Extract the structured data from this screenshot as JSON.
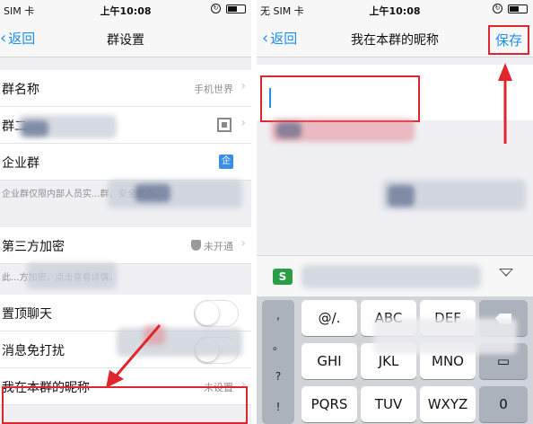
{
  "left_screen": {
    "status": {
      "carrier": "SIM 卡",
      "time": "上午10:08"
    },
    "nav": {
      "back_label": "返回",
      "title": "群设置"
    },
    "rows": {
      "group_name": {
        "label": "群名称",
        "value": "手机世界"
      },
      "group_code": {
        "label": "群二"
      },
      "enterprise": {
        "label": "企业群",
        "badge": "企",
        "desc": "企业群仅限内部人员实...群，安全放心。"
      },
      "third_party": {
        "label": "第三方加密",
        "value": "未开通",
        "desc": "此...方加密，点击查看详情。"
      },
      "pin_chat": {
        "label": "置顶聊天"
      },
      "mute": {
        "label": "消息免打扰"
      },
      "my_nickname": {
        "label": "我在本群的昵称",
        "value": "未设置"
      }
    }
  },
  "right_screen": {
    "status": {
      "carrier": "无 SIM 卡",
      "time": "上午10:08"
    },
    "nav": {
      "back_label": "返回",
      "title": "我在本群的昵称",
      "save_label": "保存"
    },
    "input": {
      "value": ""
    },
    "keyboard": {
      "symbols": [
        ",",
        "。",
        "?",
        "!"
      ],
      "rows": [
        [
          "@/.",
          "ABC",
          "DEF"
        ],
        [
          "GHI",
          "JKL",
          "MNO"
        ],
        [
          "PQRS",
          "TUV",
          "WXYZ"
        ]
      ],
      "zero": "0",
      "toolbar_logo": "S"
    }
  },
  "colors": {
    "accent": "#1b8eef",
    "highlight": "#e0262d",
    "keyboard_bg": "#d1d4d9"
  }
}
